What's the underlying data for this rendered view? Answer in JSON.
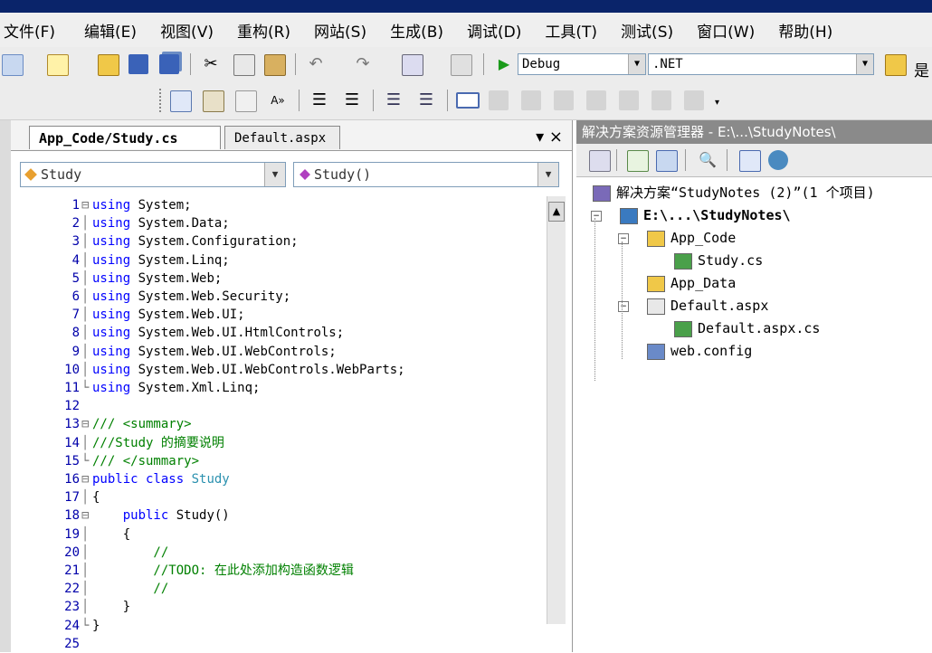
{
  "menu": [
    "文件(F)",
    "编辑(E)",
    "视图(V)",
    "重构(R)",
    "网站(S)",
    "生成(B)",
    "调试(D)",
    "工具(T)",
    "测试(S)",
    "窗口(W)",
    "帮助(H)"
  ],
  "toolbar": {
    "config": "Debug",
    "platform": ".NET",
    "overflow_char": "是"
  },
  "editor": {
    "tabs": [
      {
        "label": "App_Code/Study.cs",
        "active": true
      },
      {
        "label": "Default.aspx",
        "active": false
      }
    ],
    "controls": "▾ ×",
    "type_combo": "Study",
    "member_combo": "Study()",
    "lines": [
      {
        "n": "1",
        "g": "⊟",
        "parts": [
          [
            "kw",
            "using"
          ],
          [
            "",
            "System;"
          ]
        ]
      },
      {
        "n": "2",
        "g": "│",
        "parts": [
          [
            "kw",
            "using"
          ],
          [
            "",
            "System.Data;"
          ]
        ]
      },
      {
        "n": "3",
        "g": "│",
        "parts": [
          [
            "kw",
            "using"
          ],
          [
            "",
            "System.Configuration;"
          ]
        ]
      },
      {
        "n": "4",
        "g": "│",
        "parts": [
          [
            "kw",
            "using"
          ],
          [
            "",
            "System.Linq;"
          ]
        ]
      },
      {
        "n": "5",
        "g": "│",
        "parts": [
          [
            "kw",
            "using"
          ],
          [
            "",
            "System.Web;"
          ]
        ]
      },
      {
        "n": "6",
        "g": "│",
        "parts": [
          [
            "kw",
            "using"
          ],
          [
            "",
            "System.Web.Security;"
          ]
        ]
      },
      {
        "n": "7",
        "g": "│",
        "parts": [
          [
            "kw",
            "using"
          ],
          [
            "",
            "System.Web.UI;"
          ]
        ]
      },
      {
        "n": "8",
        "g": "│",
        "parts": [
          [
            "kw",
            "using"
          ],
          [
            "",
            "System.Web.UI.HtmlControls;"
          ]
        ]
      },
      {
        "n": "9",
        "g": "│",
        "parts": [
          [
            "kw",
            "using"
          ],
          [
            "",
            "System.Web.UI.WebControls;"
          ]
        ]
      },
      {
        "n": "10",
        "g": "│",
        "parts": [
          [
            "kw",
            "using"
          ],
          [
            "",
            "System.Web.UI.WebControls.WebParts;"
          ]
        ]
      },
      {
        "n": "11",
        "g": "└",
        "parts": [
          [
            "kw",
            "using"
          ],
          [
            "",
            "System.Xml.Linq;"
          ]
        ]
      },
      {
        "n": "12",
        "g": " ",
        "parts": []
      },
      {
        "n": "13",
        "g": "⊟",
        "parts": [
          [
            "cm",
            "/// <summary>"
          ]
        ]
      },
      {
        "n": "14",
        "g": "│",
        "parts": [
          [
            "cm",
            "///Study 的摘要说明"
          ]
        ]
      },
      {
        "n": "15",
        "g": "└",
        "parts": [
          [
            "cm",
            "/// </summary>"
          ]
        ]
      },
      {
        "n": "16",
        "g": "⊟",
        "parts": [
          [
            "kw",
            "public class"
          ],
          [
            "ty",
            "Study"
          ]
        ]
      },
      {
        "n": "17",
        "g": "│",
        "parts": [
          [
            "",
            "{"
          ]
        ]
      },
      {
        "n": "18",
        "g": "⊟",
        "parts": [
          [
            "",
            "    "
          ],
          [
            "kw",
            "public"
          ],
          [
            "",
            "Study()"
          ]
        ]
      },
      {
        "n": "19",
        "g": "│",
        "parts": [
          [
            "",
            "    {"
          ]
        ]
      },
      {
        "n": "20",
        "g": "│",
        "parts": [
          [
            "cm",
            "        //"
          ]
        ]
      },
      {
        "n": "21",
        "g": "│",
        "parts": [
          [
            "cm",
            "        //TODO: 在此处添加构造函数逻辑"
          ]
        ]
      },
      {
        "n": "22",
        "g": "│",
        "parts": [
          [
            "cm",
            "        //"
          ]
        ]
      },
      {
        "n": "23",
        "g": "│",
        "parts": [
          [
            "",
            "    }"
          ]
        ]
      },
      {
        "n": "24",
        "g": "└",
        "parts": [
          [
            "",
            "}"
          ]
        ]
      },
      {
        "n": "25",
        "g": " ",
        "parts": []
      }
    ]
  },
  "solution_explorer": {
    "title": "解决方案资源管理器 - E:\\...\\StudyNotes\\",
    "nodes": [
      {
        "label": "解决方案“StudyNotes (2)”(1 个项目)",
        "indent": 0,
        "icon": "solution-icon",
        "bold": false
      },
      {
        "label": "E:\\...\\StudyNotes\\",
        "indent": 1,
        "icon": "website-icon",
        "bold": true
      },
      {
        "label": "App_Code",
        "indent": 2,
        "icon": "folder-icon",
        "bold": false
      },
      {
        "label": "Study.cs",
        "indent": 3,
        "icon": "cs-file-icon",
        "bold": false
      },
      {
        "label": "App_Data",
        "indent": 2,
        "icon": "folder-icon",
        "bold": false
      },
      {
        "label": "Default.aspx",
        "indent": 2,
        "icon": "aspx-file-icon",
        "bold": false
      },
      {
        "label": "Default.aspx.cs",
        "indent": 3,
        "icon": "cs-file-icon",
        "bold": false
      },
      {
        "label": "web.config",
        "indent": 2,
        "icon": "config-file-icon",
        "bold": false
      }
    ]
  }
}
